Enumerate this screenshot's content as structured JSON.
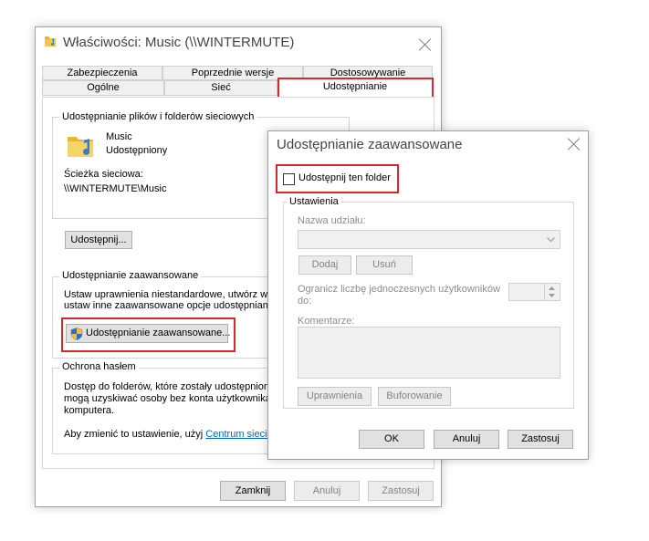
{
  "main": {
    "title": "Właściwości: Music (\\\\WINTERMUTE)",
    "tabs_top": [
      "Zabezpieczenia",
      "Poprzednie wersje",
      "Dostosowywanie"
    ],
    "tabs_bottom": [
      "Ogólne",
      "Sieć",
      "Udostępnianie"
    ],
    "network_share_group": "Udostępnianie plików i folderów sieciowych",
    "folder_name": "Music",
    "folder_status": "Udostępniony",
    "network_path_label": "Ścieżka sieciowa:",
    "network_path": "\\\\WINTERMUTE\\Music",
    "share_button": "Udostępnij...",
    "advanced_group": "Udostępnianie zaawansowane",
    "advanced_desc_1": "Ustaw uprawnienia niestandardowe, utwórz wie",
    "advanced_desc_2": "ustaw inne zaawansowane opcje udostępniania",
    "advanced_button": "Udostępnianie zaawansowane...",
    "password_group": "Ochrona hasłem",
    "password_desc_1": "Dostęp do folderów, które zostały udostępnione",
    "password_desc_2": "mogą uzyskiwać osoby bez konta użytkownika",
    "password_desc_3": "komputera.",
    "password_change": "Aby zmienić to ustawienie, użyj ",
    "network_center_link": "Centrum sieci i u",
    "close_button": "Zamknij",
    "cancel_button": "Anuluj",
    "apply_button": "Zastosuj"
  },
  "dialog": {
    "title": "Udostępnianie zaawansowane",
    "share_checkbox": "Udostępnij ten folder",
    "settings_group": "Ustawienia",
    "share_name_label": "Nazwa udziału:",
    "add_button": "Dodaj",
    "remove_button": "Usuń",
    "limit_label_1": "Ogranicz liczbę jednoczesnych użytkowników",
    "limit_label_2": "do:",
    "comments_label": "Komentarze:",
    "permissions_button": "Uprawnienia",
    "caching_button": "Buforowanie",
    "ok_button": "OK",
    "cancel_button": "Anuluj",
    "apply_button": "Zastosuj"
  },
  "colors": {
    "highlight": "#d9272e",
    "folder": "#f3c745"
  }
}
